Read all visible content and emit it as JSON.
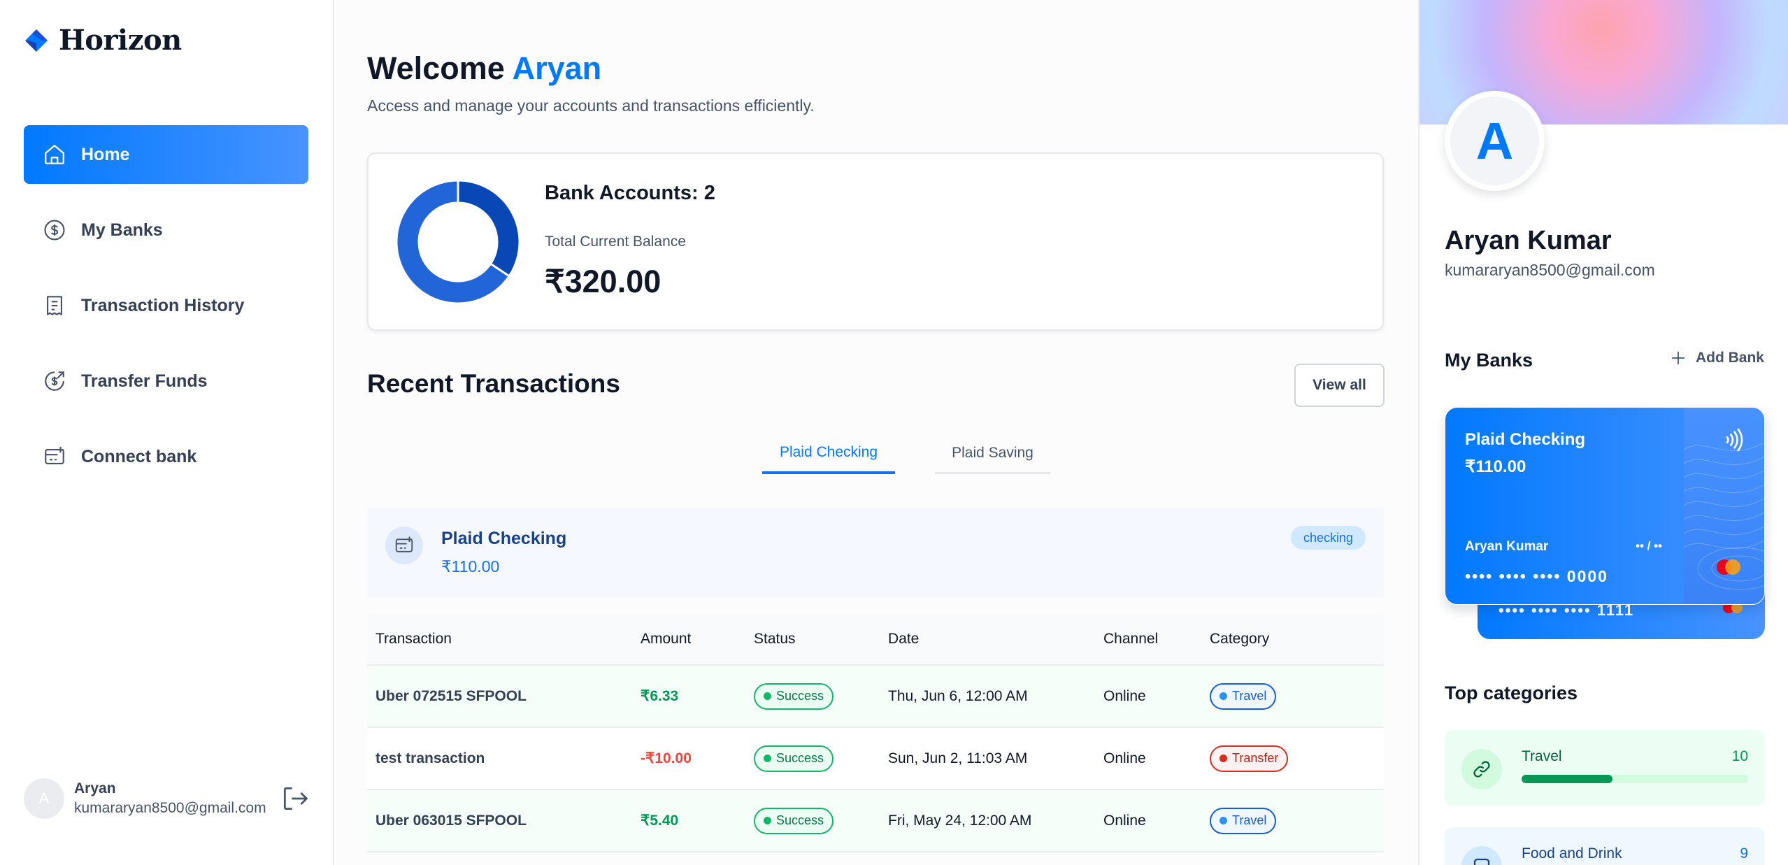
{
  "brand": {
    "name": "Horizon"
  },
  "sidebar": {
    "items": [
      {
        "label": "Home",
        "icon": "home-icon",
        "active": true
      },
      {
        "label": "My Banks",
        "icon": "dollar-circle-icon",
        "active": false
      },
      {
        "label": "Transaction History",
        "icon": "receipt-icon",
        "active": false
      },
      {
        "label": "Transfer Funds",
        "icon": "money-send-icon",
        "active": false
      },
      {
        "label": "Connect bank",
        "icon": "connect-bank-icon",
        "active": false
      }
    ],
    "user": {
      "initial": "A",
      "name": "Aryan",
      "email": "kumararyan8500@gmail.com"
    }
  },
  "header": {
    "greeting": "Welcome",
    "name": "Aryan",
    "subtitle": "Access and manage your accounts and transactions efficiently."
  },
  "balance": {
    "accounts_label": "Bank Accounts: 2",
    "total_label": "Total Current Balance",
    "total_value": "₹320.00",
    "chart_data": {
      "type": "pie",
      "categories": [
        "Plaid Checking",
        "Plaid Saving"
      ],
      "values": [
        110,
        210
      ]
    }
  },
  "recent": {
    "title": "Recent Transactions",
    "view_all": "View all",
    "tabs": [
      {
        "label": "Plaid Checking",
        "active": true
      },
      {
        "label": "Plaid Saving",
        "active": false
      }
    ],
    "account": {
      "name": "Plaid Checking",
      "balance": "₹110.00",
      "type": "checking"
    },
    "columns": [
      "Transaction",
      "Amount",
      "Status",
      "Date",
      "Channel",
      "Category"
    ],
    "rows": [
      {
        "name": "Uber 072515 SFPOOL",
        "amount": "₹6.33",
        "status": "Success",
        "date": "Thu, Jun 6, 12:00 AM",
        "channel": "Online",
        "category": "Travel"
      },
      {
        "name": "test transaction",
        "amount": "-₹10.00",
        "status": "Success",
        "date": "Sun, Jun 2, 11:03 AM",
        "channel": "Online",
        "category": "Transfer"
      },
      {
        "name": "Uber 063015 SFPOOL",
        "amount": "₹5.40",
        "status": "Success",
        "date": "Fri, May 24, 12:00 AM",
        "channel": "Online",
        "category": "Travel"
      }
    ]
  },
  "profile": {
    "initial": "A",
    "name": "Aryan Kumar",
    "email": "kumararyan8500@gmail.com"
  },
  "mybanks": {
    "title": "My Banks",
    "add_label": "Add Bank",
    "cards": [
      {
        "name": "Plaid Checking",
        "balance": "₹110.00",
        "holder": "Aryan Kumar",
        "expiry": "•• / ••",
        "number": "•••• •••• •••• 0000"
      },
      {
        "number": "•••• •••• •••• 1111"
      }
    ]
  },
  "categories": {
    "title": "Top categories",
    "items": [
      {
        "name": "Travel",
        "count": "10",
        "progress": 0.4
      },
      {
        "name": "Food and Drink",
        "count": "9"
      }
    ]
  },
  "colors": {
    "accent": "#0179fe",
    "success": "#039855",
    "danger": "#f04438"
  }
}
